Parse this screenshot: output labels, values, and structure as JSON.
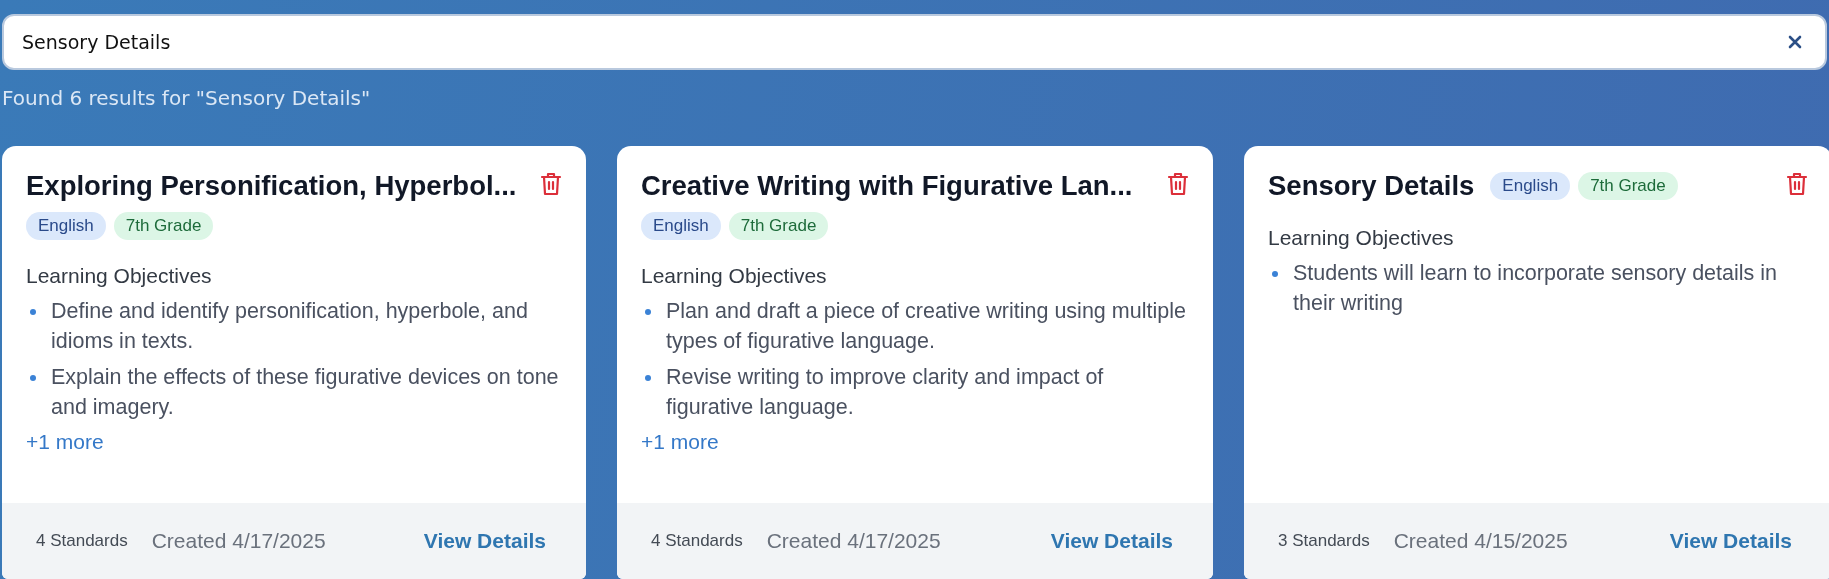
{
  "search": {
    "value": "Sensory Details"
  },
  "results_summary": "Found 6 results for \"Sensory Details\"",
  "cards": [
    {
      "title": "Exploring Personification, Hyperbol...",
      "tags": [
        {
          "label": "English",
          "color": "#dbe8fb"
        },
        {
          "label": "7th Grade",
          "color": "#dcf6e6"
        }
      ],
      "section_title": "Learning Objectives",
      "objectives": [
        "Define and identify personification, hyperbole, and idioms in texts.",
        "Explain the effects of these figurative devices on tone and imagery."
      ],
      "more": "+1 more",
      "standards": "4 Standards",
      "created": "Created 4/17/2025",
      "action": "View Details"
    },
    {
      "title": "Creative Writing with Figurative Lan...",
      "tags": [
        {
          "label": "English",
          "color": "#dbe8fb"
        },
        {
          "label": "7th Grade",
          "color": "#dcf6e6"
        }
      ],
      "section_title": "Learning Objectives",
      "objectives": [
        "Plan and draft a piece of creative writing using multiple types of figurative language.",
        "Revise writing to improve clarity and impact of figurative language."
      ],
      "more": "+1 more",
      "standards": "4 Standards",
      "created": "Created 4/17/2025",
      "action": "View Details"
    },
    {
      "title": "Sensory Details",
      "tags": [
        {
          "label": "English",
          "color": "#dbe8fb"
        },
        {
          "label": "7th Grade",
          "color": "#dcf6e6"
        }
      ],
      "section_title": "Learning Objectives",
      "objectives": [
        "Students will learn to incorporate sensory details in their writing"
      ],
      "standards": "3 Standards",
      "created": "Created 4/15/2025",
      "action": "View Details"
    }
  ]
}
